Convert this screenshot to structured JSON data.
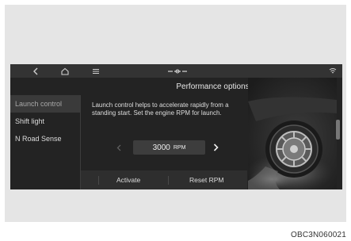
{
  "topbar": {
    "back_icon": "chevron-left-icon",
    "home_icon": "home-icon",
    "menu_icon": "menu-icon",
    "status_icon": "connection-status-icon",
    "signal_icon": "signal-icon"
  },
  "title": "Performance options",
  "sidebar": {
    "items": [
      {
        "label": "Launch control",
        "active": true
      },
      {
        "label": "Shift light",
        "active": false
      },
      {
        "label": "N Road Sense",
        "active": false
      }
    ]
  },
  "description": "Launch control helps to accelerate rapidly from a standing start. Set the engine RPM for launch.",
  "rpm": {
    "value": "3000",
    "unit": "RPM"
  },
  "buttons": {
    "activate": "Activate",
    "reset": "Reset RPM"
  },
  "caption": "OBC3N060021",
  "colors": {
    "screen_bg": "#232323",
    "topbar_bg": "#333333",
    "panel_bg": "#e5e5e5"
  }
}
